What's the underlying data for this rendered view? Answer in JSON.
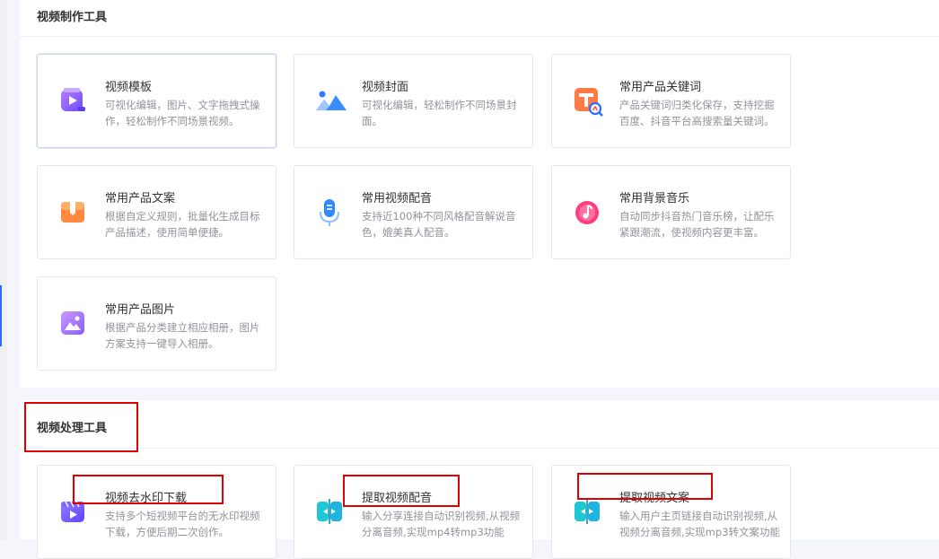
{
  "sections": [
    {
      "title": "视频制作工具",
      "cards": [
        {
          "title": "视频模板",
          "desc": "可视化编辑，图片、文字拖拽式操作，轻松制作不同场景视频。",
          "icon": "video-template-icon"
        },
        {
          "title": "视频封面",
          "desc": "可视化编辑，轻松制作不同场景封面。",
          "icon": "mountain-cover-icon"
        },
        {
          "title": "常用产品关键词",
          "desc": "产品关键词归类化保存，支持挖掘百度、抖音平台高搜索量关键词。",
          "icon": "keyword-search-icon"
        },
        {
          "title": "常用产品文案",
          "desc": "根据自定义规则，批量化生成目标产品描述，使用简单便捷。",
          "icon": "product-box-icon"
        },
        {
          "title": "常用视频配音",
          "desc": "支持近100种不同风格配音解说音色，媲美真人配音。",
          "icon": "microphone-icon"
        },
        {
          "title": "常用背景音乐",
          "desc": "自动同步抖音热门音乐榜，让配乐紧跟潮流，使视频内容更丰富。",
          "icon": "music-note-icon"
        },
        {
          "title": "常用产品图片",
          "desc": "根据产品分类建立相应相册，图片方案支持一键导入相册。",
          "icon": "image-album-icon"
        }
      ]
    },
    {
      "title": "视频处理工具",
      "cards": [
        {
          "title": "视频去水印下载",
          "desc": "支持多个短视频平台的无水印视频下载，方便后期二次创作。",
          "icon": "watermark-remove-icon"
        },
        {
          "title": "提取视频配音",
          "desc": "输入分享连接自动识别视频,从视频分离音频,实现mp4转mp3功能",
          "icon": "extract-audio-icon"
        },
        {
          "title": "提取视频文案",
          "desc": "输入用户主页链接自动识别视频,从视频分离音频,实现mp3转文案功能",
          "icon": "extract-text-icon"
        }
      ]
    }
  ],
  "colors": {
    "accent": "#3a64ff",
    "highlight": "#e00000"
  }
}
